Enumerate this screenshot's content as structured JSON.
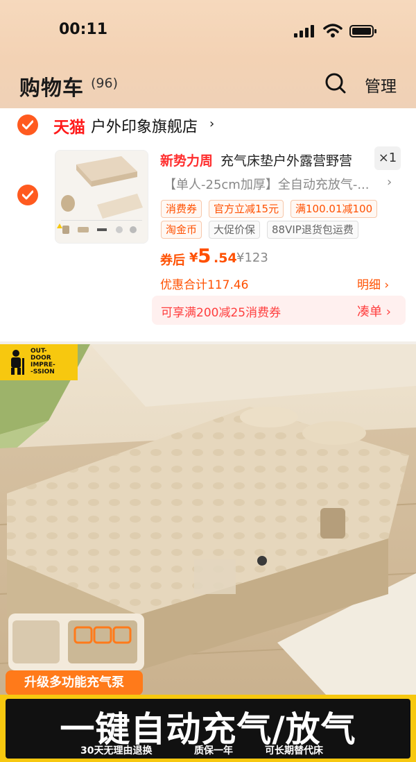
{
  "status_bar": {
    "time": "00:11"
  },
  "header": {
    "title": "购物车",
    "count": "(96)",
    "manage_label": "管理"
  },
  "shop": {
    "brand": "天猫",
    "name": "户外印象旗舰店",
    "arrow": "›"
  },
  "item": {
    "promo_tag": "新势力周",
    "title": "充气床垫户外露营野营",
    "quantity": "×1",
    "sku": "【单人-25cm加厚】全自动充放气-...",
    "sku_arrow": "›",
    "tags": [
      "消费券",
      "官方立减15元",
      "满100.01减100",
      "淘金币",
      "大促价保",
      "88VIP退货包运费"
    ],
    "after_label": "券后",
    "price_yen": "¥",
    "price_int": "5",
    "price_dec": ".54",
    "original_price": "¥123",
    "discount_total": "优惠合计117.46",
    "detail_label": "明细 ›",
    "coupon_text": "可享满200减25消费券",
    "coupon_button": "凑单 ›"
  },
  "ad": {
    "logo_text": "OUT-\nDOOR\nIMPRE-\n-SSION",
    "upgrade_label": "升级多功能充气泵",
    "headline": "一键自动充气/放气",
    "features": [
      "30天无理由退换",
      "质保一年",
      "可长期替代床"
    ]
  },
  "colors": {
    "accent": "#ff5000",
    "checkbox": "#ff5a1f",
    "tmall": "#ff1a1a",
    "banner_yellow": "#f7c80f"
  },
  "icons": [
    "signal-icon",
    "wifi-icon",
    "battery-icon",
    "search-icon",
    "check-icon"
  ]
}
